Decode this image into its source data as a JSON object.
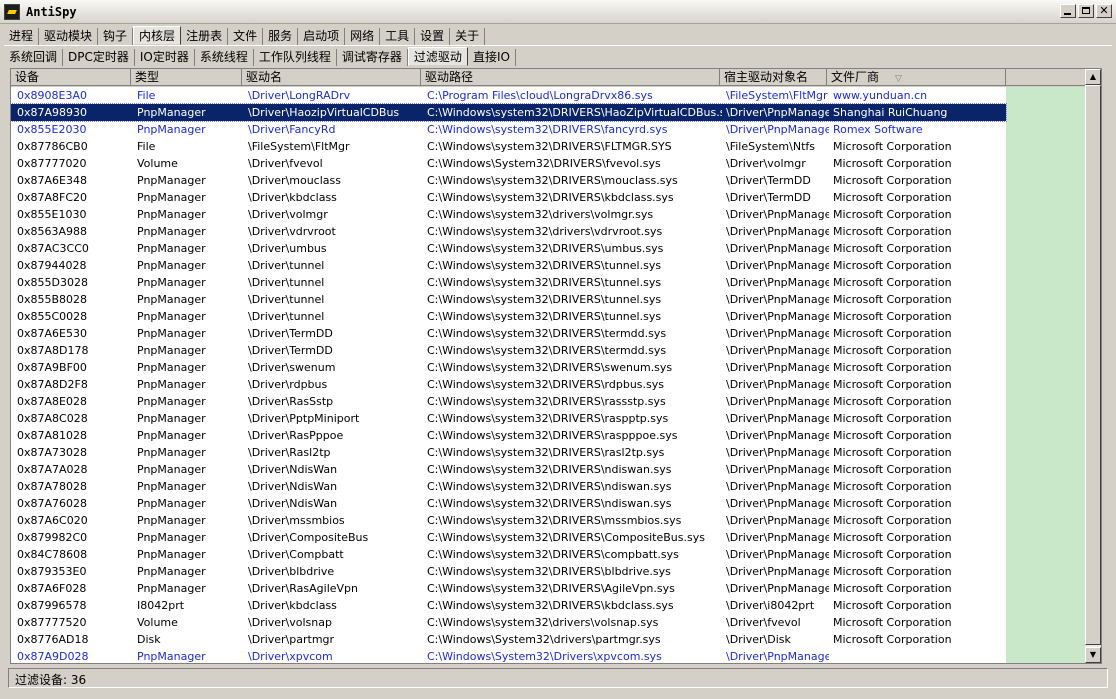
{
  "window": {
    "title": "AntiSpy"
  },
  "main_tabs": [
    "进程",
    "驱动模块",
    "钩子",
    "内核层",
    "注册表",
    "文件",
    "服务",
    "启动项",
    "网络",
    "工具",
    "设置",
    "关于"
  ],
  "main_tab_active": 3,
  "sub_tabs": [
    "系统回调",
    "DPC定时器",
    "IO定时器",
    "系统线程",
    "工作队列线程",
    "调试寄存器",
    "过滤驱动",
    "直接IO"
  ],
  "sub_tab_active": 6,
  "columns": [
    "设备",
    "类型",
    "驱动名",
    "驱动路径",
    "宿主驱动对象名",
    "文件厂商"
  ],
  "rows": [
    [
      "0x8908E3A0",
      "File",
      "\\Driver\\LongRADrv",
      "C:\\Program Files\\cloud\\LongraDrvx86.sys",
      "\\FileSystem\\FltMgr",
      "www.yunduan.cn"
    ],
    [
      "0x87A98930",
      "PnpManager",
      "\\Driver\\HaozipVirtualCDBus",
      "C:\\Windows\\system32\\DRIVERS\\HaoZipVirtualCDBus.sys",
      "\\Driver\\PnpManager",
      "Shanghai RuiChuang"
    ],
    [
      "0x855E2030",
      "PnpManager",
      "\\Driver\\FancyRd",
      "C:\\Windows\\system32\\DRIVERS\\fancyrd.sys",
      "\\Driver\\PnpManager",
      "Romex Software"
    ],
    [
      "0x87786CB0",
      "File",
      "\\FileSystem\\FltMgr",
      "C:\\Windows\\system32\\DRIVERS\\FLTMGR.SYS",
      "\\FileSystem\\Ntfs",
      "Microsoft Corporation"
    ],
    [
      "0x87777020",
      "Volume",
      "\\Driver\\fvevol",
      "C:\\Windows\\System32\\DRIVERS\\fvevol.sys",
      "\\Driver\\volmgr",
      "Microsoft Corporation"
    ],
    [
      "0x87A6E348",
      "PnpManager",
      "\\Driver\\mouclass",
      "C:\\Windows\\system32\\DRIVERS\\mouclass.sys",
      "\\Driver\\TermDD",
      "Microsoft Corporation"
    ],
    [
      "0x87A8FC20",
      "PnpManager",
      "\\Driver\\kbdclass",
      "C:\\Windows\\system32\\DRIVERS\\kbdclass.sys",
      "\\Driver\\TermDD",
      "Microsoft Corporation"
    ],
    [
      "0x855E1030",
      "PnpManager",
      "\\Driver\\volmgr",
      "C:\\Windows\\system32\\drivers\\volmgr.sys",
      "\\Driver\\PnpManager",
      "Microsoft Corporation"
    ],
    [
      "0x8563A988",
      "PnpManager",
      "\\Driver\\vdrvroot",
      "C:\\Windows\\system32\\drivers\\vdrvroot.sys",
      "\\Driver\\PnpManager",
      "Microsoft Corporation"
    ],
    [
      "0x87AC3CC0",
      "PnpManager",
      "\\Driver\\umbus",
      "C:\\Windows\\system32\\DRIVERS\\umbus.sys",
      "\\Driver\\PnpManager",
      "Microsoft Corporation"
    ],
    [
      "0x87944028",
      "PnpManager",
      "\\Driver\\tunnel",
      "C:\\Windows\\system32\\DRIVERS\\tunnel.sys",
      "\\Driver\\PnpManager",
      "Microsoft Corporation"
    ],
    [
      "0x855D3028",
      "PnpManager",
      "\\Driver\\tunnel",
      "C:\\Windows\\system32\\DRIVERS\\tunnel.sys",
      "\\Driver\\PnpManager",
      "Microsoft Corporation"
    ],
    [
      "0x855B8028",
      "PnpManager",
      "\\Driver\\tunnel",
      "C:\\Windows\\system32\\DRIVERS\\tunnel.sys",
      "\\Driver\\PnpManager",
      "Microsoft Corporation"
    ],
    [
      "0x855C0028",
      "PnpManager",
      "\\Driver\\tunnel",
      "C:\\Windows\\system32\\DRIVERS\\tunnel.sys",
      "\\Driver\\PnpManager",
      "Microsoft Corporation"
    ],
    [
      "0x87A6E530",
      "PnpManager",
      "\\Driver\\TermDD",
      "C:\\Windows\\system32\\DRIVERS\\termdd.sys",
      "\\Driver\\PnpManager",
      "Microsoft Corporation"
    ],
    [
      "0x87A8D178",
      "PnpManager",
      "\\Driver\\TermDD",
      "C:\\Windows\\system32\\DRIVERS\\termdd.sys",
      "\\Driver\\PnpManager",
      "Microsoft Corporation"
    ],
    [
      "0x87A9BF00",
      "PnpManager",
      "\\Driver\\swenum",
      "C:\\Windows\\system32\\DRIVERS\\swenum.sys",
      "\\Driver\\PnpManager",
      "Microsoft Corporation"
    ],
    [
      "0x87A8D2F8",
      "PnpManager",
      "\\Driver\\rdpbus",
      "C:\\Windows\\system32\\DRIVERS\\rdpbus.sys",
      "\\Driver\\PnpManager",
      "Microsoft Corporation"
    ],
    [
      "0x87A8E028",
      "PnpManager",
      "\\Driver\\RasSstp",
      "C:\\Windows\\system32\\DRIVERS\\rassstp.sys",
      "\\Driver\\PnpManager",
      "Microsoft Corporation"
    ],
    [
      "0x87A8C028",
      "PnpManager",
      "\\Driver\\PptpMiniport",
      "C:\\Windows\\system32\\DRIVERS\\raspptp.sys",
      "\\Driver\\PnpManager",
      "Microsoft Corporation"
    ],
    [
      "0x87A81028",
      "PnpManager",
      "\\Driver\\RasPppoe",
      "C:\\Windows\\system32\\DRIVERS\\raspppoe.sys",
      "\\Driver\\PnpManager",
      "Microsoft Corporation"
    ],
    [
      "0x87A73028",
      "PnpManager",
      "\\Driver\\Rasl2tp",
      "C:\\Windows\\system32\\DRIVERS\\rasl2tp.sys",
      "\\Driver\\PnpManager",
      "Microsoft Corporation"
    ],
    [
      "0x87A7A028",
      "PnpManager",
      "\\Driver\\NdisWan",
      "C:\\Windows\\system32\\DRIVERS\\ndiswan.sys",
      "\\Driver\\PnpManager",
      "Microsoft Corporation"
    ],
    [
      "0x87A78028",
      "PnpManager",
      "\\Driver\\NdisWan",
      "C:\\Windows\\system32\\DRIVERS\\ndiswan.sys",
      "\\Driver\\PnpManager",
      "Microsoft Corporation"
    ],
    [
      "0x87A76028",
      "PnpManager",
      "\\Driver\\NdisWan",
      "C:\\Windows\\system32\\DRIVERS\\ndiswan.sys",
      "\\Driver\\PnpManager",
      "Microsoft Corporation"
    ],
    [
      "0x87A6C020",
      "PnpManager",
      "\\Driver\\mssmbios",
      "C:\\Windows\\system32\\DRIVERS\\mssmbios.sys",
      "\\Driver\\PnpManager",
      "Microsoft Corporation"
    ],
    [
      "0x879982C0",
      "PnpManager",
      "\\Driver\\CompositeBus",
      "C:\\Windows\\system32\\DRIVERS\\CompositeBus.sys",
      "\\Driver\\PnpManager",
      "Microsoft Corporation"
    ],
    [
      "0x84C78608",
      "PnpManager",
      "\\Driver\\Compbatt",
      "C:\\Windows\\system32\\DRIVERS\\compbatt.sys",
      "\\Driver\\PnpManager",
      "Microsoft Corporation"
    ],
    [
      "0x879353E0",
      "PnpManager",
      "\\Driver\\blbdrive",
      "C:\\Windows\\system32\\DRIVERS\\blbdrive.sys",
      "\\Driver\\PnpManager",
      "Microsoft Corporation"
    ],
    [
      "0x87A6F028",
      "PnpManager",
      "\\Driver\\RasAgileVpn",
      "C:\\Windows\\system32\\DRIVERS\\AgileVpn.sys",
      "\\Driver\\PnpManager",
      "Microsoft Corporation"
    ],
    [
      "0x87996578",
      "I8042prt",
      "\\Driver\\kbdclass",
      "C:\\Windows\\system32\\DRIVERS\\kbdclass.sys",
      "\\Driver\\i8042prt",
      "Microsoft Corporation"
    ],
    [
      "0x87777520",
      "Volume",
      "\\Driver\\volsnap",
      "C:\\Windows\\system32\\drivers\\volsnap.sys",
      "\\Driver\\fvevol",
      "Microsoft Corporation"
    ],
    [
      "0x8776AD18",
      "Disk",
      "\\Driver\\partmgr",
      "C:\\Windows\\System32\\drivers\\partmgr.sys",
      "\\Driver\\Disk",
      "Microsoft Corporation"
    ],
    [
      "0x87A9D028",
      "PnpManager",
      "\\Driver\\xpvcom",
      "C:\\Windows\\System32\\Drivers\\xpvcom.sys",
      "\\Driver\\PnpManager",
      ""
    ]
  ],
  "row_styles": [
    "blue",
    "selected",
    "blue",
    "",
    "",
    "",
    "",
    "",
    "",
    "",
    "",
    "",
    "",
    "",
    "",
    "",
    "",
    "",
    "",
    "",
    "",
    "",
    "",
    "",
    "",
    "",
    "",
    "",
    "",
    "",
    "",
    "",
    "",
    "blue"
  ],
  "colors": {
    "highlight_text": "#1d2bd8",
    "selection": "#0a246a",
    "side_green": "#c9e8c9"
  },
  "status": {
    "text": "过滤设备: 36"
  }
}
